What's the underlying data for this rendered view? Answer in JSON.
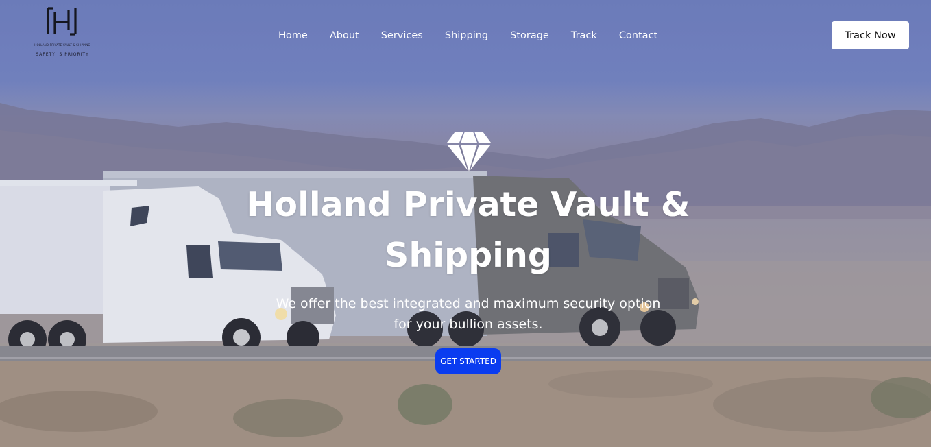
{
  "brand": {
    "tagline": "HOLLAND PRIVATE VAULT & SHIPPING",
    "motto": "SAFETY IS PRIORITY",
    "logo_icon": "h-monogram-icon"
  },
  "nav": {
    "items": [
      {
        "label": "Home"
      },
      {
        "label": "About"
      },
      {
        "label": "Services"
      },
      {
        "label": "Shipping"
      },
      {
        "label": "Storage"
      },
      {
        "label": "Track"
      },
      {
        "label": "Contact"
      }
    ],
    "cta_label": "Track Now"
  },
  "hero": {
    "icon": "diamond-icon",
    "title_line1": "Holland Private Vault &",
    "title_line2": "Shipping",
    "subtitle_line1": "We offer the best integrated and maximum security option",
    "subtitle_line2": "for your bullion assets.",
    "button_label": "GET STARTED",
    "background_image": "trucks-on-desert-highway"
  },
  "colors": {
    "cta_blue": "#0a3cf0",
    "text_white": "#ffffff",
    "sky": "#7585c1"
  }
}
